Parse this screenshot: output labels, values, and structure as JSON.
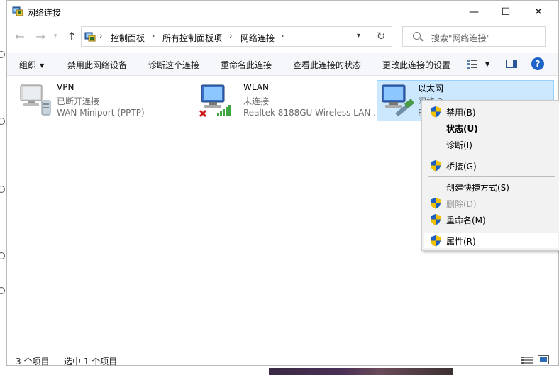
{
  "window": {
    "title": "网络连接"
  },
  "titlebar": {
    "minimize": "—",
    "maximize": "☐",
    "close": "✕"
  },
  "nav": {
    "back": "←",
    "forward": "→",
    "up": "↑",
    "refresh": "↻"
  },
  "breadcrumb": [
    "控制面板",
    "所有控制面板项",
    "网络连接"
  ],
  "search": {
    "placeholder": "搜索\"网络连接\""
  },
  "toolbar": {
    "organize": "组织",
    "disable": "禁用此网络设备",
    "diagnose": "诊断这个连接",
    "rename": "重命名此连接",
    "view_status": "查看此连接的状态",
    "change_settings": "更改此连接的设置",
    "help": "?"
  },
  "connections": [
    {
      "name": "VPN",
      "status": "已断开连接",
      "device": "WAN Miniport (PPTP)"
    },
    {
      "name": "WLAN",
      "status": "未连接",
      "device": "Realtek 8188GU Wireless LAN ..."
    },
    {
      "name": "以太网",
      "status": "网络 2",
      "device": "R"
    }
  ],
  "statusbar": {
    "item_count": "3 个项目",
    "selected": "选中 1 个项目"
  },
  "context_menu": {
    "disable": "禁用(B)",
    "status": "状态(U)",
    "diagnose": "诊断(I)",
    "bridge": "桥接(G)",
    "shortcut": "创建快捷方式(S)",
    "delete": "删除(D)",
    "rename": "重命名(M)",
    "properties": "属性(R)"
  },
  "colors": {
    "selection": "#cce8ff",
    "selection_border": "#99d1ff",
    "help": "#1e64c8",
    "menu_bg": "#f2f2f2"
  }
}
